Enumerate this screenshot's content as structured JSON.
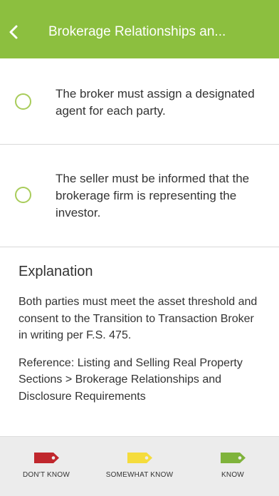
{
  "header": {
    "title": "Brokerage Relationships an...",
    "back_icon": "chevron-left-icon",
    "color": "#8cbf3f"
  },
  "options": [
    {
      "text": "The broker must assign a designated agent for each party."
    },
    {
      "text": "The seller must be informed that the brokerage firm is representing the investor."
    }
  ],
  "explanation": {
    "title": "Explanation",
    "body": "Both parties must meet the asset threshold and consent to the Transition to Transaction Broker in writing per F.S. 475.",
    "reference": "Reference: Listing and Selling Real Property Sections > Brokerage Relationships and Disclosure Requirements"
  },
  "footer": {
    "buttons": [
      {
        "label": "DON'T KNOW",
        "icon": "red-tag-icon",
        "color": "#c0272d"
      },
      {
        "label": "SOMEWHAT KNOW",
        "icon": "yellow-tag-icon",
        "color": "#f5dc3c"
      },
      {
        "label": "KNOW",
        "icon": "green-tag-icon",
        "color": "#7fb33b"
      }
    ]
  }
}
